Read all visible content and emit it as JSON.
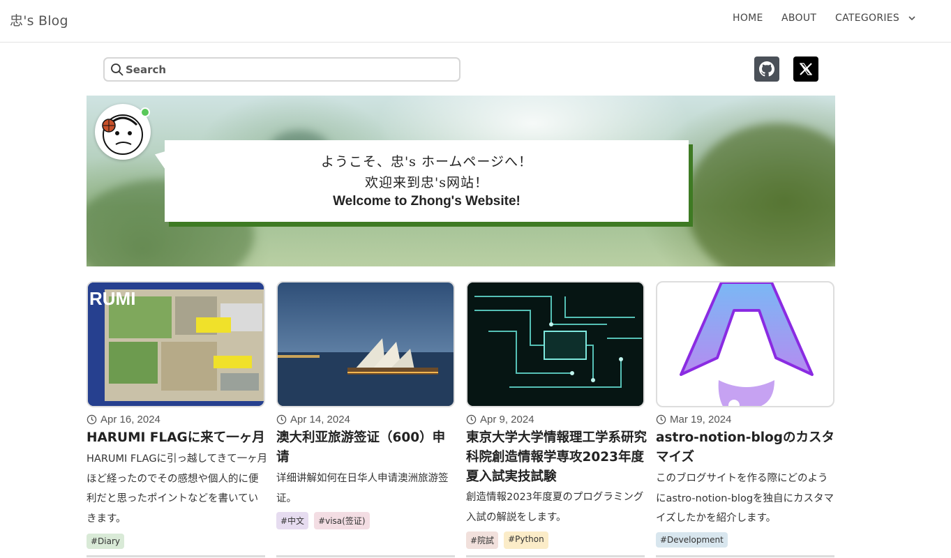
{
  "header": {
    "brand": "忠's Blog",
    "nav": {
      "home": "HOME",
      "about": "ABOUT",
      "categories": "CATEGORIES"
    }
  },
  "search": {
    "placeholder": "Search"
  },
  "social": [
    "github-icon",
    "x-icon"
  ],
  "hero": {
    "line1": "ようこそ、忠's ホームページへ！",
    "line2": "欢迎来到忠's网站！",
    "line3": "Welcome to Zhong's Website!"
  },
  "posts": [
    {
      "date": "Apr 16, 2024",
      "title": "HARUMI FLAGに来て一ヶ月",
      "excerpt": "HARUMI FLAGに引っ越してきて一ヶ月ほど経ったのでその感想や個人的に便利だと思ったポイントなどを書いていきます。",
      "tags": [
        {
          "label": "#Diary",
          "color": "#d9ead7"
        }
      ]
    },
    {
      "date": "Apr 14, 2024",
      "title": "澳大利亚旅游签证（600）申请",
      "excerpt": "详细讲解如何在日华人申请澳洲旅游签证。",
      "tags": [
        {
          "label": "#中文",
          "color": "#e6dcf0"
        },
        {
          "label": "#visa(签证)",
          "color": "#f3dde3"
        }
      ]
    },
    {
      "date": "Apr 9, 2024",
      "title": "東京大学大学情報理工学系研究科院創造情報学専攻2023年度夏入試実技試験",
      "excerpt": "創造情報2023年度夏のプログラミング入試の解説をします。",
      "tags": [
        {
          "label": "#院試",
          "color": "#f1e0dc"
        },
        {
          "label": "#Python",
          "color": "#fbecc8"
        }
      ]
    },
    {
      "date": "Mar 19, 2024",
      "title": "astro-notion-blogのカスタマイズ",
      "excerpt": "このブログサイトを作る際にどのようにastro-notion-blogを独自にカスタマイズしたかを紹介します。",
      "tags": [
        {
          "label": "#Development",
          "color": "#d8e6ee"
        }
      ]
    }
  ],
  "thumb_labels": {
    "harumi": "RUMI"
  },
  "colors": {
    "bubble_shadow": "#3e7a23",
    "online": "#5ac85a"
  }
}
